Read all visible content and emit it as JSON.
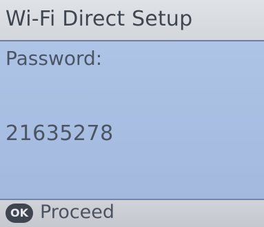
{
  "title_bar": {
    "title": "Wi-Fi Direct Setup"
  },
  "content": {
    "password_label": "Password:",
    "password_value": "21635278"
  },
  "footer": {
    "ok_icon_label": "OK",
    "proceed_label": "Proceed"
  },
  "colors": {
    "content_background": "#a9bfe2",
    "title_background": "#d6dadf",
    "text": "#4a5564"
  }
}
